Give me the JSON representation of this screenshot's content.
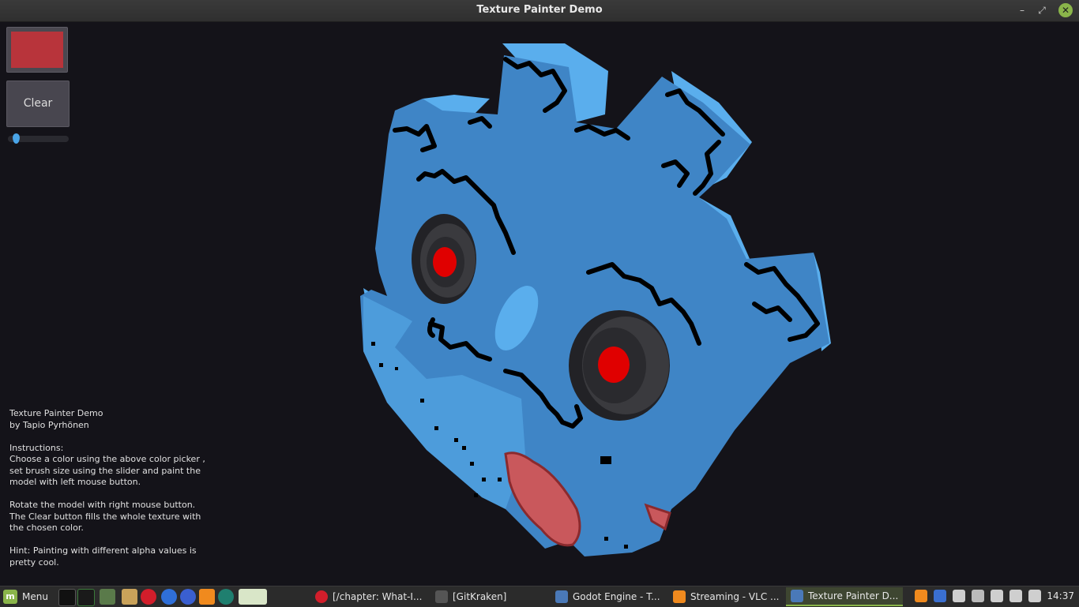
{
  "window": {
    "title": "Texture Painter Demo",
    "minimize_label": "–",
    "restore_label": "⤢",
    "close_label": "✕"
  },
  "controls": {
    "brush_color": "#b8343b",
    "clear_label": "Clear",
    "brush_size": 0.05
  },
  "info": {
    "text": "Texture Painter Demo\nby Tapio Pyrhönen\n\nInstructions:\nChoose a color using the above color picker ,\nset brush size using the slider and paint the\nmodel with left mouse button.\n\nRotate the model with right mouse button.\nThe Clear button fills the whole texture with\nthe chosen color.\n\nHint: Painting with different alpha values is\npretty cool."
  },
  "model": {
    "face_color": "#3f85c6",
    "side_color": "#5aaeed",
    "paint_color": "#000000",
    "tongue_color": "#c9585c",
    "eye_color": "#e00000"
  },
  "taskbar": {
    "menu_label": "Menu",
    "tasks": [
      {
        "label": "[/chapter: What-I...",
        "icon": "opera-icon"
      },
      {
        "label": "[GitKraken]",
        "icon": "gitkraken-icon"
      },
      {
        "label": "Godot Engine - T...",
        "icon": "godot-icon"
      },
      {
        "label": "Streaming - VLC ...",
        "icon": "vlc-icon"
      },
      {
        "label": "Texture Painter D...",
        "icon": "godot-icon"
      }
    ],
    "clock": "14:37"
  }
}
